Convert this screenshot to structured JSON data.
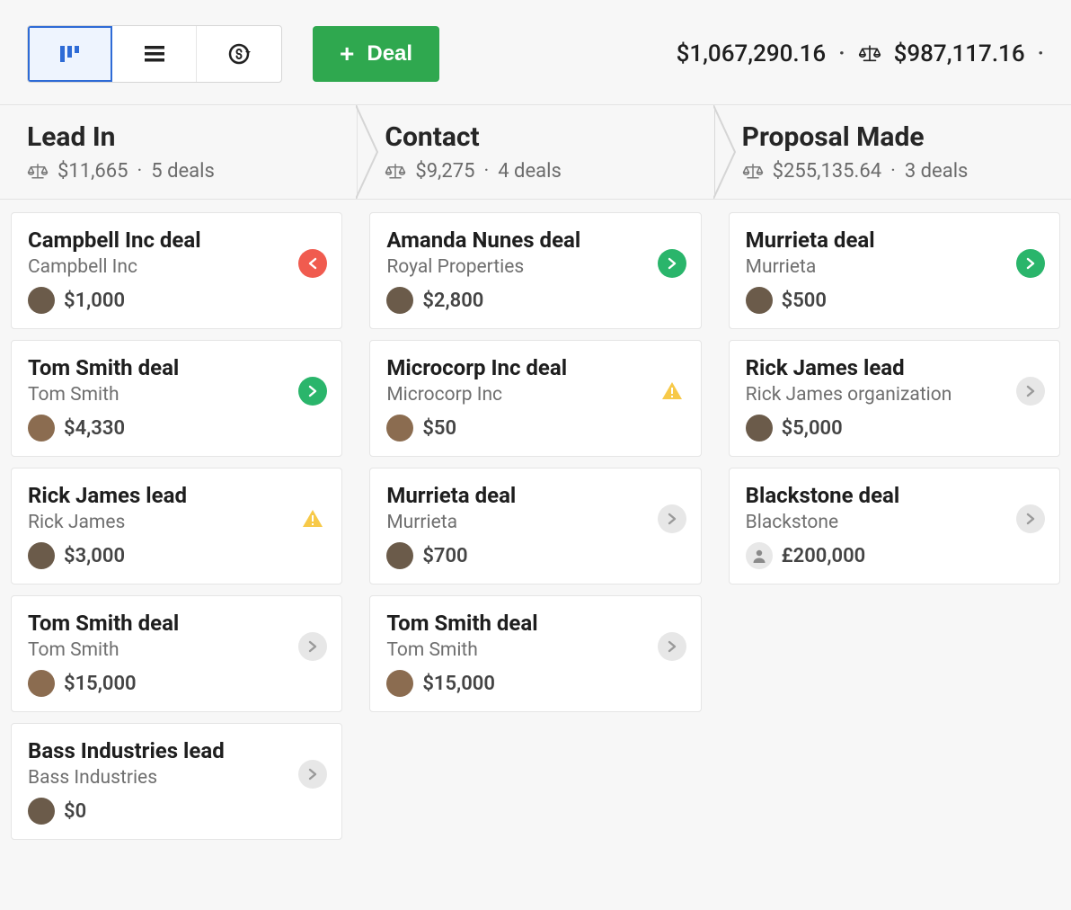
{
  "toolbar": {
    "add_deal_label": "Deal",
    "total_plain": "$1,067,290.16",
    "total_weighted": "$987,117.16"
  },
  "stages": [
    {
      "title": "Lead In",
      "amount": "$11,665",
      "deals": "5 deals"
    },
    {
      "title": "Contact",
      "amount": "$9,275",
      "deals": "4 deals"
    },
    {
      "title": "Proposal Made",
      "amount": "$255,135.64",
      "deals": "3 deals"
    }
  ],
  "columns": [
    [
      {
        "title": "Campbell Inc deal",
        "sub": "Campbell Inc",
        "amount": "$1,000",
        "avatar": "dark",
        "status": "red"
      },
      {
        "title": "Tom Smith deal",
        "sub": "Tom Smith",
        "amount": "$4,330",
        "avatar": "alt",
        "status": "green"
      },
      {
        "title": "Rick James lead",
        "sub": "Rick James",
        "amount": "$3,000",
        "avatar": "dark",
        "status": "warn"
      },
      {
        "title": "Tom Smith deal",
        "sub": "Tom Smith",
        "amount": "$15,000",
        "avatar": "alt",
        "status": "gray"
      },
      {
        "title": "Bass Industries lead",
        "sub": "Bass Industries",
        "amount": "$0",
        "avatar": "dark",
        "status": "gray"
      }
    ],
    [
      {
        "title": "Amanda Nunes deal",
        "sub": "Royal Properties",
        "amount": "$2,800",
        "avatar": "dark",
        "status": "green"
      },
      {
        "title": "Microcorp Inc deal",
        "sub": "Microcorp Inc",
        "amount": "$50",
        "avatar": "alt",
        "status": "warn"
      },
      {
        "title": "Murrieta deal",
        "sub": "Murrieta",
        "amount": "$700",
        "avatar": "dark",
        "status": "gray"
      },
      {
        "title": "Tom Smith deal",
        "sub": "Tom Smith",
        "amount": "$15,000",
        "avatar": "alt",
        "status": "gray"
      }
    ],
    [
      {
        "title": "Murrieta deal",
        "sub": "Murrieta",
        "amount": "$500",
        "avatar": "dark",
        "status": "green"
      },
      {
        "title": "Rick James lead",
        "sub": "Rick James organization",
        "amount": "$5,000",
        "avatar": "dark",
        "status": "gray"
      },
      {
        "title": "Blackstone deal",
        "sub": "Blackstone",
        "amount": "£200,000",
        "avatar": "user",
        "status": "gray"
      }
    ]
  ]
}
